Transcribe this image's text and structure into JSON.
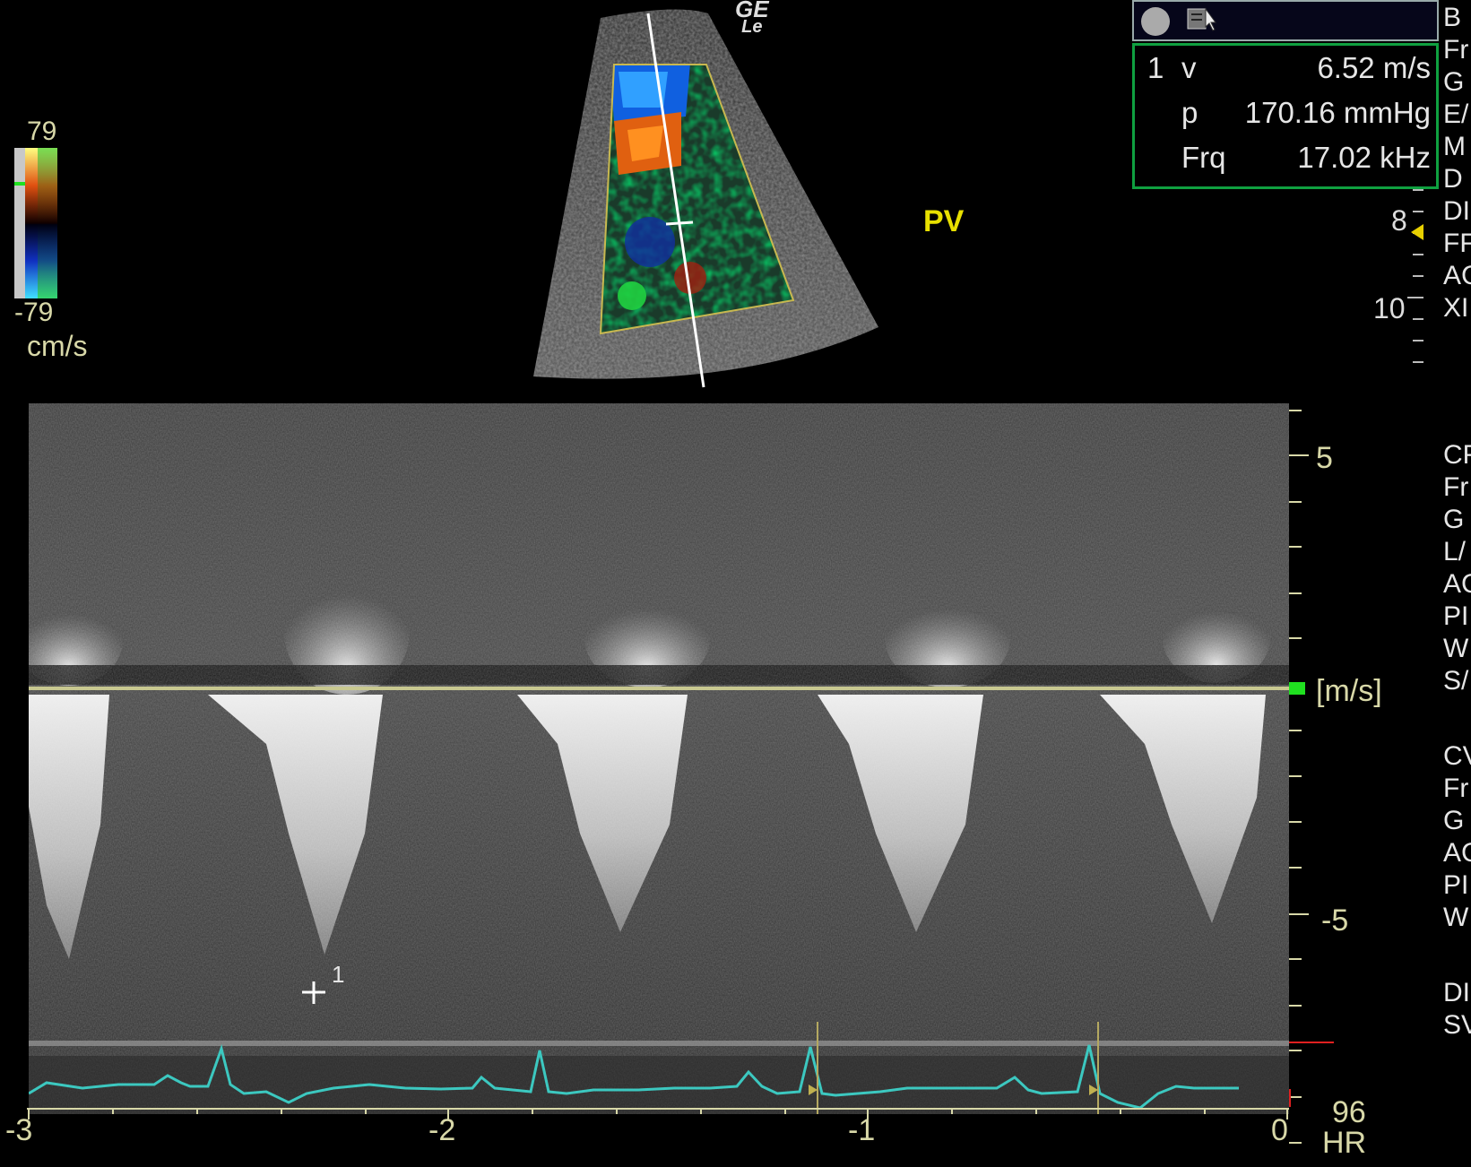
{
  "color_scale": {
    "top": "79",
    "bottom": "-79",
    "unit": "cm/s"
  },
  "logo": {
    "line1": "GE",
    "line2": "Le"
  },
  "view_label": "PV",
  "measurement": {
    "index": "1",
    "rows": [
      {
        "label": "v",
        "value": "6.52 m/s"
      },
      {
        "label": "p",
        "value": "170.16 mmHg"
      },
      {
        "label": "Frq",
        "value": "17.02 kHz"
      }
    ]
  },
  "side_panel_top": [
    "B",
    "Fr",
    "G",
    "E/",
    "M",
    "D",
    "DI",
    "FF",
    "AC",
    "XI"
  ],
  "side_panel_mid": [
    "CF",
    "Fr",
    "G",
    "L/",
    "AC",
    "PI",
    "W",
    "S/"
  ],
  "side_panel_low": [
    "CV",
    "Fr",
    "G",
    "AC",
    "PI",
    "W"
  ],
  "side_panel_bottom": [
    "DI",
    "SV"
  ],
  "depth_labels": {
    "a": "8",
    "b": "10"
  },
  "velocity_axis": {
    "unit": "[m/s]",
    "ticks": [
      "5",
      "-5"
    ]
  },
  "time_axis": {
    "ticks": [
      "-3",
      "-2",
      "-1",
      "0"
    ]
  },
  "heart_rate": {
    "value": "96",
    "label": "HR"
  },
  "cursor_label": "1",
  "colors": {
    "accent_yellow": "#e8e000",
    "axis_khaki": "#d8d8a8",
    "ecg_teal": "#3cc8c0",
    "meas_green": "#0fa040"
  }
}
